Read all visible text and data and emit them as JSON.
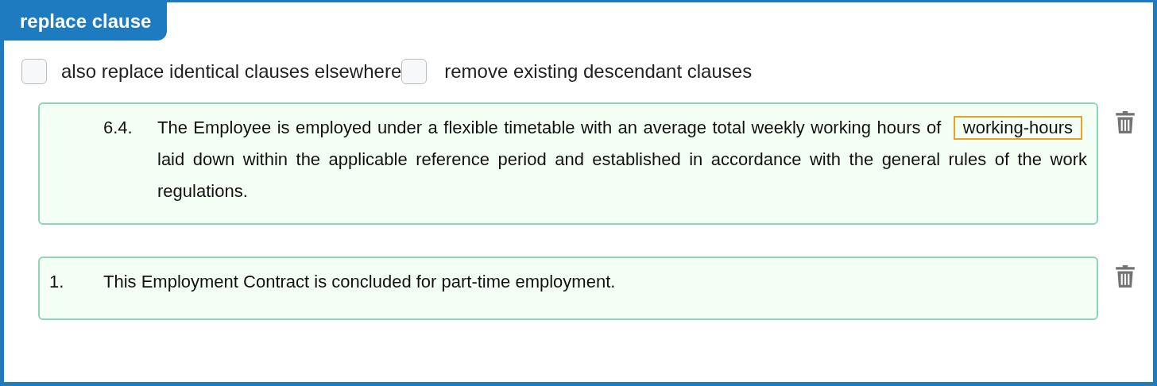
{
  "title": "replace clause",
  "options": [
    {
      "label": "also replace identical clauses elsewhere",
      "checked": false
    },
    {
      "label": "remove existing descendant clauses",
      "checked": false
    }
  ],
  "clauses": [
    {
      "kind": "subclause",
      "number": "6.4.",
      "segments": [
        {
          "kind": "text",
          "text": "The Employee is employed under a flexible timetable with an average total weekly working hours of"
        },
        {
          "kind": "field",
          "text": "working-hours"
        },
        {
          "kind": "text",
          "text": "laid down within the applicable reference period and established in accordance with the general rules of the work regulations."
        }
      ]
    },
    {
      "kind": "clause",
      "number": "1.",
      "segments": [
        {
          "kind": "text",
          "text": "This Employment Contract is concluded for part-time employment."
        }
      ]
    }
  ]
}
